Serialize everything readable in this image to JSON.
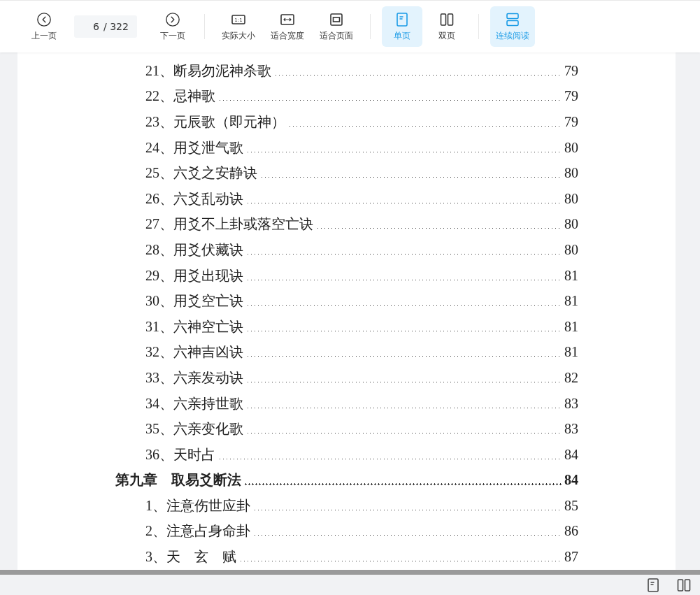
{
  "toolbar": {
    "prev": {
      "kind": "prev",
      "label": "上一页"
    },
    "page_field": {
      "value": "6",
      "total": "/ 322"
    },
    "next": {
      "kind": "next",
      "label": "下一页"
    },
    "groups": [
      [
        {
          "kind": "actual-size",
          "icon_text": "1:1",
          "label": "实际大小",
          "selected": false
        },
        {
          "kind": "fit-width",
          "label": "适合宽度",
          "selected": false
        },
        {
          "kind": "fit-page",
          "label": "适合页面",
          "selected": false
        }
      ],
      [
        {
          "kind": "single",
          "label": "单页",
          "selected": true
        },
        {
          "kind": "double",
          "label": "双页",
          "selected": false
        }
      ],
      [
        {
          "kind": "continuous",
          "label": "连续阅读",
          "selected": true
        }
      ]
    ]
  },
  "toc": [
    {
      "kind": "entry",
      "title": "21、断易勿泥神杀歌",
      "page": "79"
    },
    {
      "kind": "entry",
      "title": "22、忌神歌",
      "page": "79"
    },
    {
      "kind": "entry",
      "title": "23、元辰歌（即元神）",
      "page": "79"
    },
    {
      "kind": "entry",
      "title": "24、用爻泄气歌",
      "page": "80"
    },
    {
      "kind": "entry",
      "title": "25、六爻之安静诀",
      "page": "80"
    },
    {
      "kind": "entry",
      "title": "26、六爻乱动诀",
      "page": "80"
    },
    {
      "kind": "entry",
      "title": "27、用爻不上卦或落空亡诀",
      "page": "80"
    },
    {
      "kind": "entry",
      "title": "28、用爻伏藏诀",
      "page": "80"
    },
    {
      "kind": "entry",
      "title": "29、用爻出现诀",
      "page": "81"
    },
    {
      "kind": "entry",
      "title": "30、用爻空亡诀",
      "page": "81"
    },
    {
      "kind": "entry",
      "title": "31、六神空亡诀",
      "page": "81"
    },
    {
      "kind": "entry",
      "title": "32、六神吉凶诀",
      "page": "81"
    },
    {
      "kind": "entry",
      "title": "33、六亲发动诀",
      "page": "82"
    },
    {
      "kind": "entry",
      "title": "34、六亲持世歌",
      "page": "83"
    },
    {
      "kind": "entry",
      "title": "35、六亲变化歌",
      "page": "83"
    },
    {
      "kind": "entry",
      "title": "36、天时占",
      "page": "84"
    },
    {
      "kind": "chapter",
      "title": "第九章　取易爻断法",
      "page": "84"
    },
    {
      "kind": "entry",
      "title": "1、注意伤世应卦",
      "page": "85"
    },
    {
      "kind": "entry",
      "title": "2、注意占身命卦",
      "page": "86"
    },
    {
      "kind": "entry",
      "title": "3、天　玄　赋",
      "page": "87"
    }
  ],
  "status_bar": [
    {
      "kind": "single"
    },
    {
      "kind": "double"
    }
  ]
}
